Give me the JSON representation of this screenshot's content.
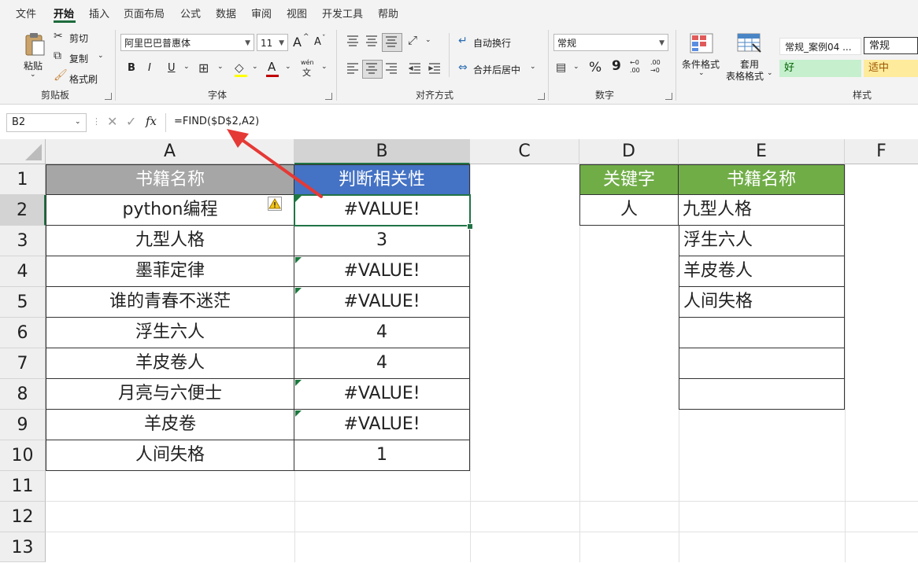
{
  "menu": {
    "items": [
      "文件",
      "开始",
      "插入",
      "页面布局",
      "公式",
      "数据",
      "审阅",
      "视图",
      "开发工具",
      "帮助"
    ],
    "active": "开始"
  },
  "ribbon": {
    "clipboard": {
      "paste": "粘贴",
      "cut": "剪切",
      "copy": "复制",
      "format_painter": "格式刷",
      "label": "剪贴板"
    },
    "font": {
      "name": "阿里巴巴普惠体",
      "size": "11",
      "bold": "B",
      "italic": "I",
      "underline": "U",
      "grow": "A",
      "shrink": "A",
      "font_color": "A",
      "phonetic_top": "wén",
      "phonetic_bottom": "文",
      "label": "字体"
    },
    "alignment": {
      "wrap": "自动换行",
      "merge": "合并后居中",
      "label": "对齐方式"
    },
    "number": {
      "format": "常规",
      "percent": "%",
      "comma": "9",
      "inc_top": "←0",
      "inc_bottom": ".00",
      "dec_top": ".00",
      "dec_bottom": "→0",
      "label": "数字"
    },
    "styles": {
      "conditional_line1": "条件格式",
      "table_line1": "套用",
      "table_line2": "表格格式",
      "style1": "常规_案例04 ...",
      "style2": "常规",
      "style3": "好",
      "style4": "适中",
      "label": "样式"
    }
  },
  "formula_bar": {
    "name_box": "B2",
    "fx": "fx",
    "formula": "=FIND($D$2,A2)"
  },
  "columns": [
    "A",
    "B",
    "C",
    "D",
    "E",
    "F"
  ],
  "rows": [
    "1",
    "2",
    "3",
    "4",
    "5",
    "6",
    "7",
    "8",
    "9",
    "10",
    "11",
    "12",
    "13"
  ],
  "table1": {
    "header_a": "书籍名称",
    "header_b": "判断相关性",
    "titles": [
      "python编程",
      "九型人格",
      "墨菲定律",
      "谁的青春不迷茫",
      "浮生六人",
      "羊皮卷人",
      "月亮与六便士",
      "羊皮卷",
      "人间失格"
    ],
    "results": [
      "#VALUE!",
      "3",
      "#VALUE!",
      "#VALUE!",
      "4",
      "4",
      "#VALUE!",
      "#VALUE!",
      "1"
    ]
  },
  "table2": {
    "header_d": "关键字",
    "header_e": "书籍名称",
    "keyword": "人",
    "matches": [
      "九型人格",
      "浮生六人",
      "羊皮卷人",
      "人间失格",
      "",
      "",
      ""
    ]
  },
  "colors": {
    "header_gray": "#a6a6a6",
    "header_blue": "#4472c4",
    "header_green": "#70ad47",
    "accent_green": "#217346",
    "arrow_red": "#e53935",
    "good_bg": "#c6efce",
    "good_fg": "#006100",
    "neutral_bg": "#ffeb9c",
    "neutral_fg": "#9c5700"
  }
}
